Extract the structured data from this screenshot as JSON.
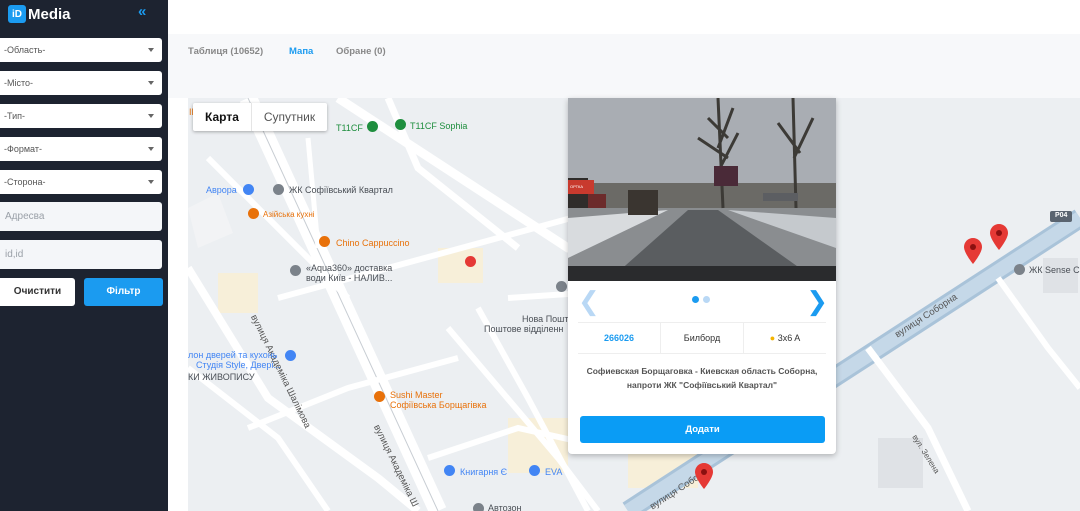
{
  "brand": {
    "badge": "iD",
    "name": "Media"
  },
  "sidebar": {
    "collapse_icon": "«",
    "selects": [
      "-Область-",
      "-Місто-",
      "-Тип-",
      "-Формат-",
      "-Сторона-"
    ],
    "address_placeholder": "Адресва",
    "ids_placeholder": "id,id",
    "clear_label": "Очистити",
    "filter_label": "Фільтр"
  },
  "tabs": [
    {
      "label": "Таблиця (10652)"
    },
    {
      "label": "Мапа"
    },
    {
      "label": "Обране (0)"
    }
  ],
  "map": {
    "type_buttons": [
      "Карта",
      "Супутник"
    ],
    "labels": {
      "t11cf": "T11CF",
      "t11cf_sophia": "T11CF Sophia",
      "avrora": "Аврора",
      "zhk_sofiivskyi": "ЖК Софіївський Квартал",
      "aziiska_kukhnia": "Азійська кухні",
      "chino": "Chino Cappuccino",
      "aqua360": "«Aqua360» доставка",
      "aqua360_2": "води Київ - НАЛИВ...",
      "nova_poshta": "Нова Пошт",
      "poshtove": "Поштове відділенн",
      "doors": "лон дверей та кухонь",
      "studiia": "Студія Style, Двері...",
      "zhyvopys": "КИ ЖИВОПИСУ",
      "sushi": "Sushi Master",
      "sushi_2": "Софіївська Борщагівка",
      "knyharnia": "Книгарня Є",
      "eva": "EVA",
      "autozone": "Автозон",
      "zhk_sense": "ЖК Sense C",
      "r04": "Р04",
      "vul_akademika": "вулиця Академіка Шалімова",
      "vul_akademika_2": "вулиця Академіка Ш",
      "vul_soborna": "вулиця Соборна",
      "vul_soborna_2": "вулиця Собо",
      "vul_zelena": "вул. Зелена",
      "ik": "ІК"
    }
  },
  "popup": {
    "id": "266026",
    "type": "Билборд",
    "size": "3x6 A",
    "address": "Софиевская Борщаговка - Киевская область Соборна, напроти ЖК \"Софіївський Квартал\"",
    "add_label": "Додати",
    "photo_sign_text": "ОРТКА"
  },
  "colors": {
    "accent": "#1b9bf0",
    "sidebar": "#1d2330",
    "pin": "#e53935"
  }
}
